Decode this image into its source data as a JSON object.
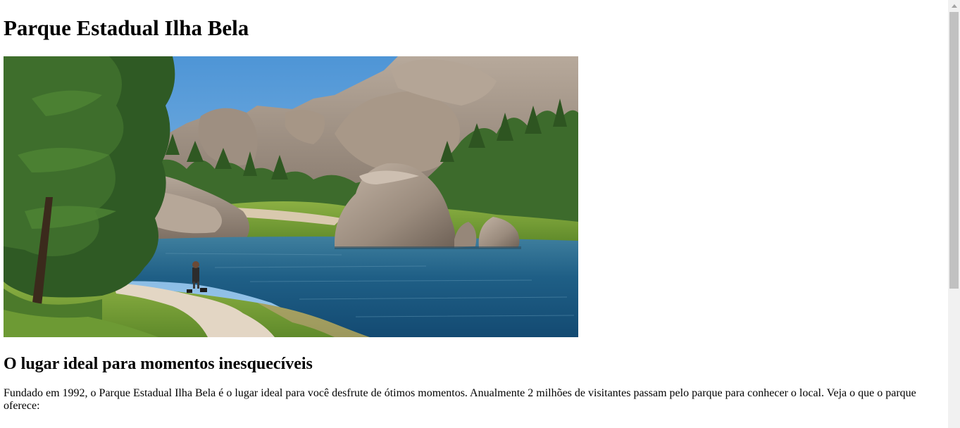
{
  "page": {
    "title": "Parque Estadual Ilha Bela",
    "hero_alt": "Parque Estadual Ilha Bela",
    "subtitle": "O lugar ideal para momentos inesquecíveis",
    "intro": "Fundado em 1992, o Parque Estadual Ilha Bela é o lugar ideal para você desfrute de ótimos momentos. Anualmente 2 milhões de visitantes passam pelo parque para conhecer o local. Veja o que o parque oferece:"
  },
  "colors": {
    "sky": "#5f9fd8",
    "water": "#1f5f86",
    "rock": "#a49587",
    "grass": "#78a33a",
    "tree": "#2f5a24"
  }
}
